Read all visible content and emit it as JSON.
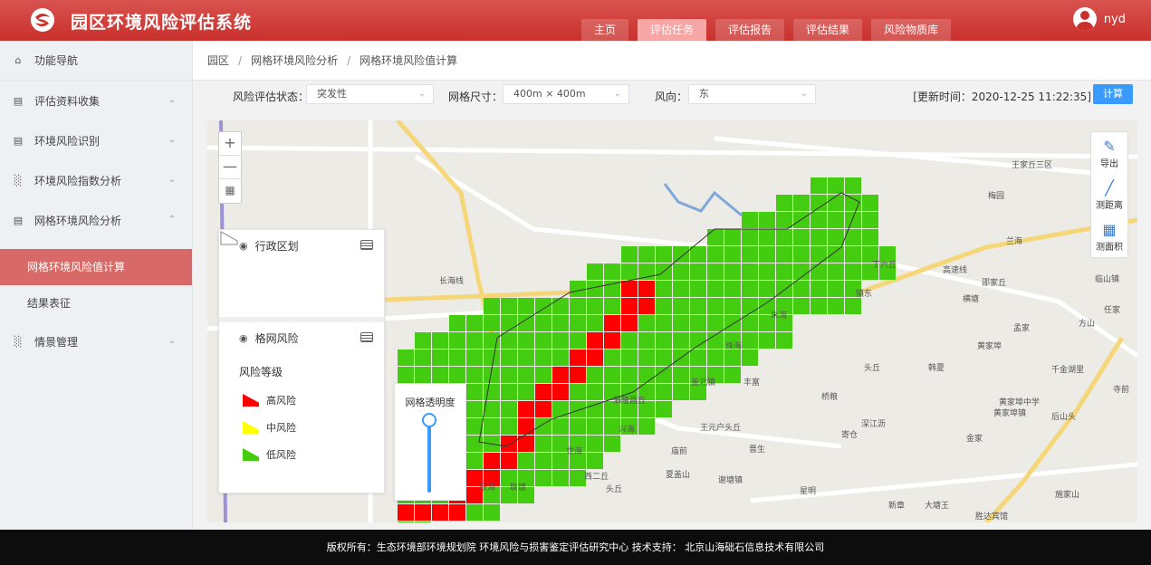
{
  "app": {
    "title": "园区环境风险评估系统",
    "user": "nyd"
  },
  "nav": {
    "tabs": [
      "主页",
      "评估任务",
      "评估报告",
      "评估结果",
      "风险物质库"
    ],
    "active": 1
  },
  "sidebar": {
    "header": "功能导航",
    "items": [
      {
        "label": "评估资料收集",
        "icon": "id-card-icon"
      },
      {
        "label": "环境风险识别",
        "icon": "id-card-icon"
      },
      {
        "label": "环境风险指数分析",
        "icon": "bar-chart-icon"
      },
      {
        "label": "网格环境风险分析",
        "icon": "id-card-icon"
      }
    ],
    "subitems": [
      "网格环境风险值计算",
      "结果表征"
    ],
    "last_item": {
      "label": "情景管理",
      "icon": "bar-chart-icon"
    }
  },
  "breadcrumb": [
    "园区",
    "网格环境风险分析",
    "网格环境风险值计算"
  ],
  "toolbar": {
    "status_label": "风险评估状态：",
    "status_value": "突发性",
    "grid_label": "网格尺寸：",
    "grid_value": "400m × 400m",
    "wind_label": "风向：",
    "wind_value": "东",
    "updated": "[更新时间：2020-12-25 11:22:35]",
    "calc_button": "计算"
  },
  "map": {
    "zoom_in": "+",
    "zoom_out": "—",
    "tools": [
      "导出",
      "测距离",
      "测面积"
    ],
    "layers": {
      "admin": "行政区划",
      "grid": "格网风险",
      "legend_title": "风险等级",
      "legend": [
        {
          "label": "高风险",
          "color": "#ff0000"
        },
        {
          "label": "中风险",
          "color": "#ffff00"
        },
        {
          "label": "低风险",
          "color": "#44cc11"
        }
      ]
    },
    "opacity_title": "网格透明度",
    "place_labels": [
      "王家丘三区",
      "梅园",
      "兰海",
      "高速线",
      "邵家丘",
      "临山镇",
      "横塘",
      "孟家",
      "方山",
      "任家",
      "黄家埠",
      "千金湖里",
      "寺前",
      "黄家埠中学",
      "黄家埠镇",
      "后山头",
      "金家",
      "施家山",
      "新章",
      "大塘王",
      "胜达宾馆",
      "镇东",
      "丁六丘",
      "朱海",
      "珠海",
      "头丘",
      "韩夏",
      "丰富",
      "盖北镇",
      "泗隆昌丘",
      "兴海",
      "王元户头丘",
      "晋生",
      "世海",
      "庙前",
      "西二丘",
      "夏盖山",
      "谢塘镇",
      "星明",
      "头丘",
      "联海",
      "联塘",
      "桥粮",
      "寄仓",
      "深江沥",
      "长海线"
    ]
  },
  "footer": "版权所有：生态环境部环境规划院 环境风险与损害鉴定评估研究中心   技术支持： 北京山海础石信息技术有限公司"
}
